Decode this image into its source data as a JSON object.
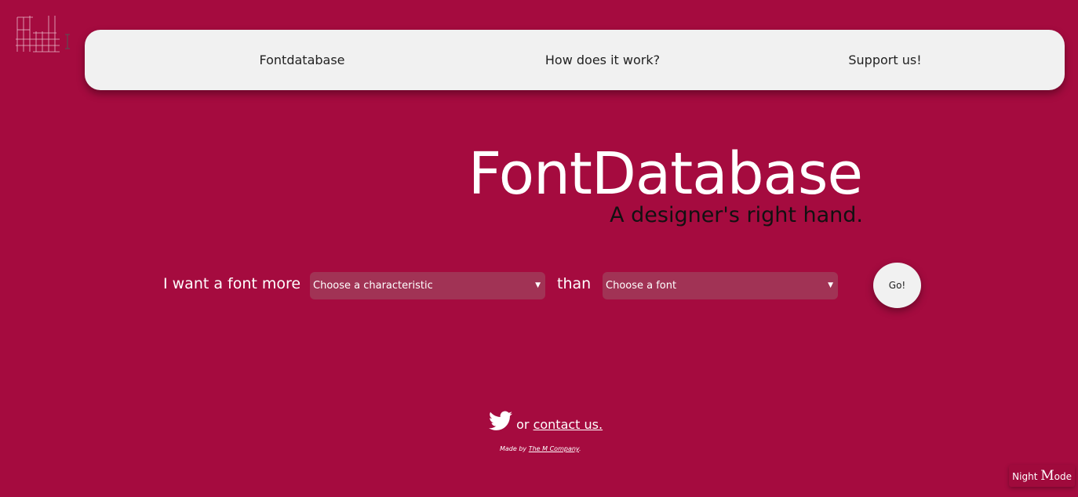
{
  "logo": {
    "icon": "fd-logo"
  },
  "nav": {
    "items": [
      {
        "label": "Fontdatabase"
      },
      {
        "label": "How does it work?"
      },
      {
        "label": "Support us!"
      }
    ]
  },
  "hero": {
    "title": "FontDatabase",
    "subtitle": "A designer's right hand."
  },
  "form": {
    "prefix_label": "I want a font more",
    "characteristic_select": "Choose a characteristic",
    "connector_label": "than",
    "font_select": "Choose a font",
    "go_label": "Go!"
  },
  "footer": {
    "twitter_icon": "twitter-icon",
    "or_text": "or",
    "contact_link": "contact us.",
    "made_by_prefix": "Made by",
    "company_link": "The M Company",
    "made_by_suffix": "."
  },
  "night_mode": {
    "prefix": "Night",
    "m": "M",
    "suffix": "ode"
  },
  "colors": {
    "background": "#a50b3f",
    "navbar": "#f1f1f1",
    "select_bg": "#a13355"
  }
}
